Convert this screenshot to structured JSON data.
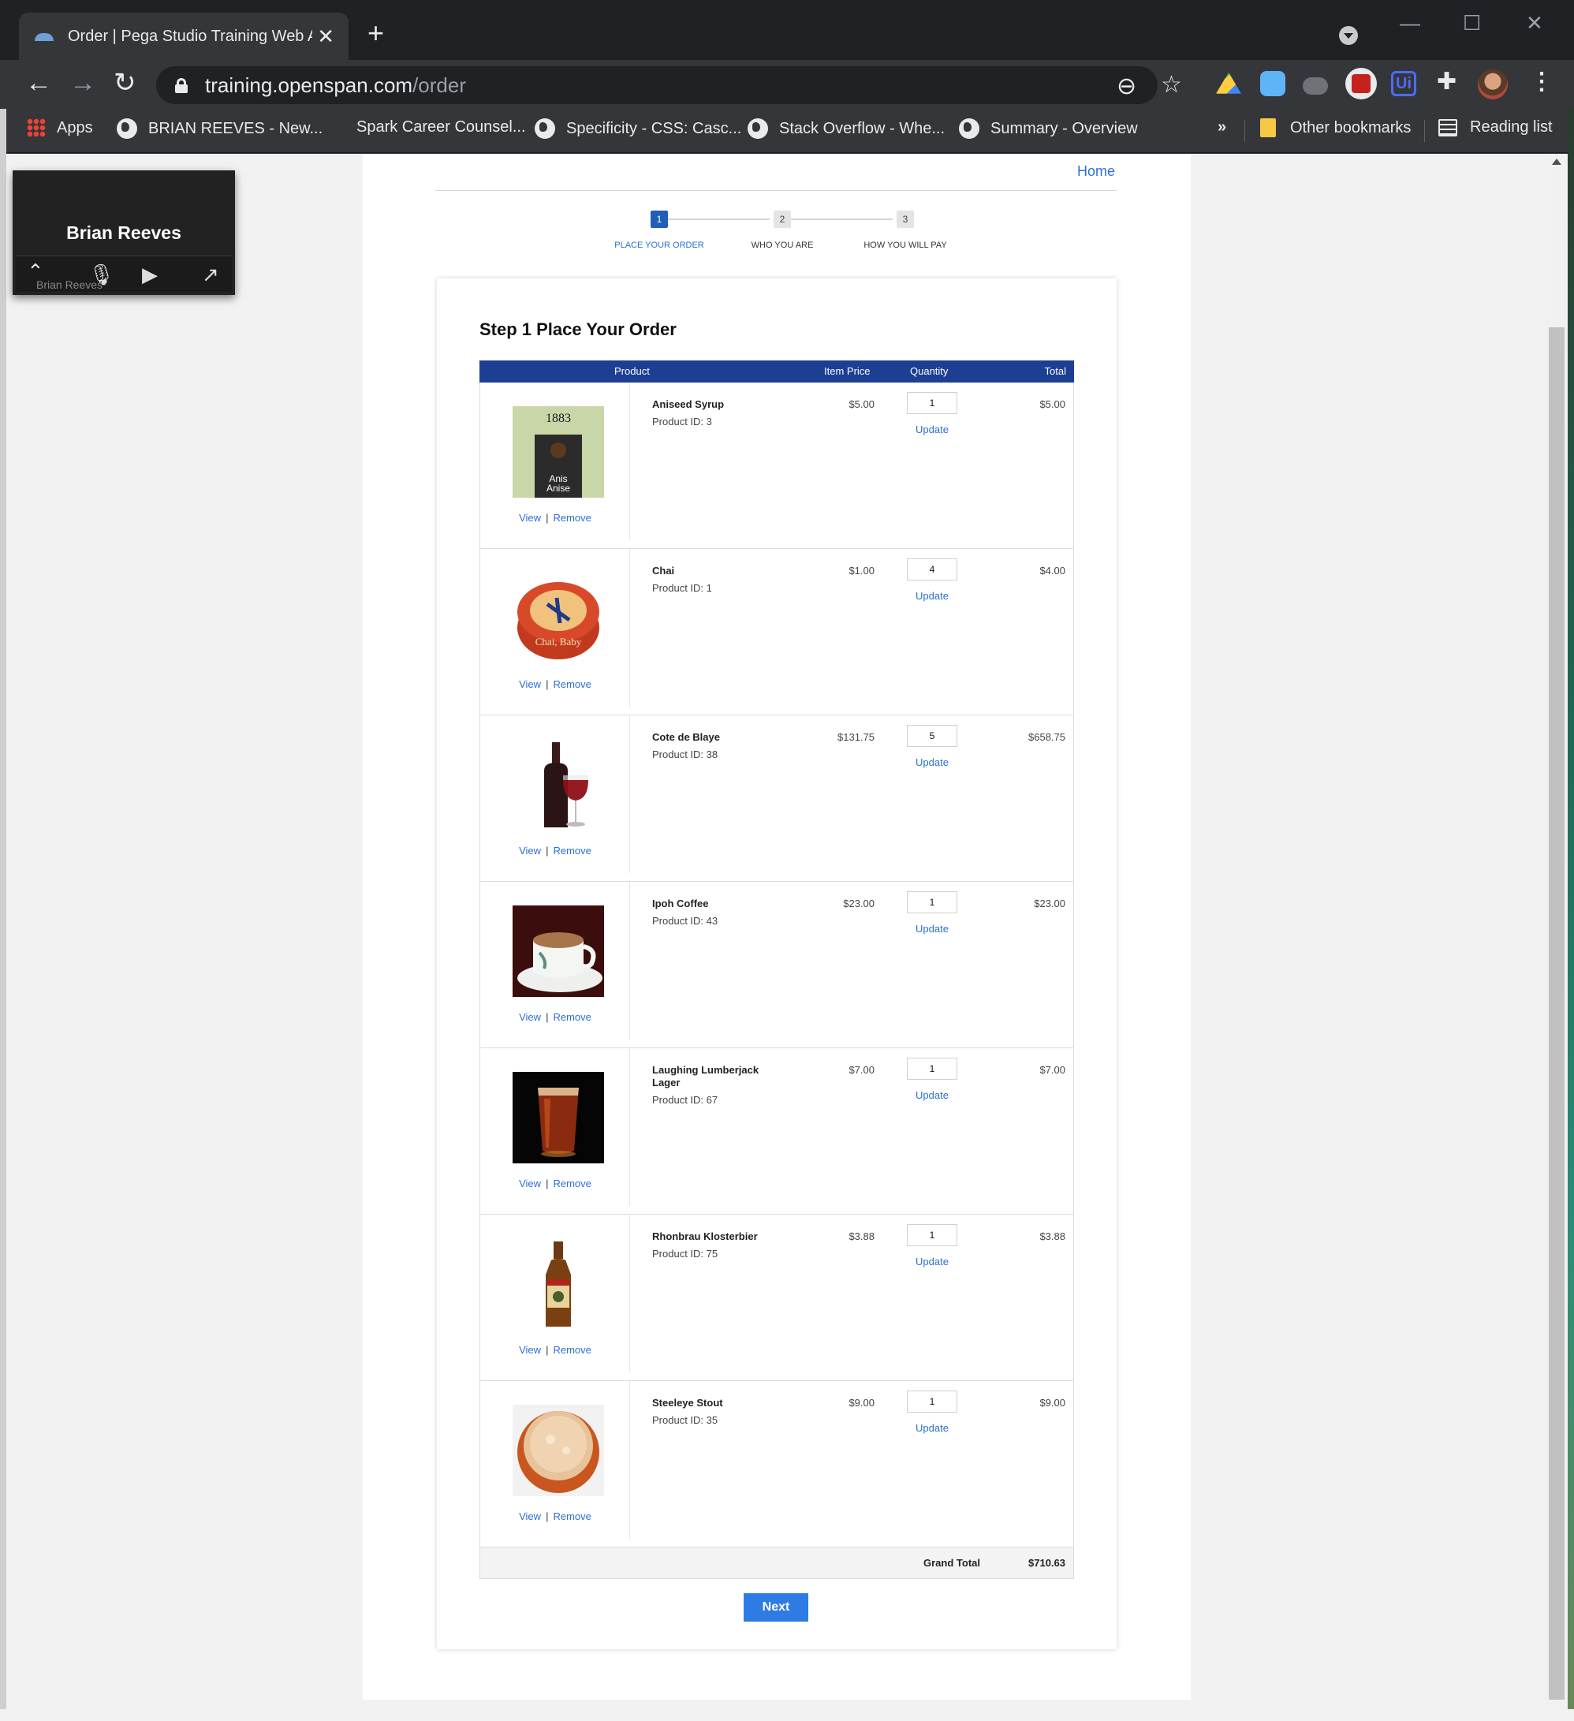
{
  "browser": {
    "tab_title": "Order | Pega Studio Training Web Ap",
    "url_host": "training.openspan.com",
    "url_path": "/order",
    "bookmarks": [
      {
        "label": "Apps",
        "icon": "apps-grid-icon"
      },
      {
        "label": "BRIAN REEVES - New...",
        "icon": "globe-icon"
      },
      {
        "label": "Spark Career Counsel...",
        "icon": "none"
      },
      {
        "label": "Specificity - CSS: Casc...",
        "icon": "globe-icon"
      },
      {
        "label": "Stack Overflow - Whe...",
        "icon": "globe-icon"
      },
      {
        "label": "Summary - Overview",
        "icon": "globe-icon"
      }
    ],
    "other_bookmarks": "Other bookmarks",
    "reading_list": "Reading list"
  },
  "zoom_overlay": {
    "name": "Brian Reeves",
    "sub_name": "Brian Reeves"
  },
  "page": {
    "home_link": "Home",
    "steps": [
      {
        "num": "1",
        "label": "PLACE YOUR ORDER",
        "active": true
      },
      {
        "num": "2",
        "label": "WHO YOU ARE",
        "active": false
      },
      {
        "num": "3",
        "label": "HOW YOU WILL PAY",
        "active": false
      }
    ],
    "title": "Step 1 Place Your Order",
    "columns": {
      "product": "Product",
      "price": "Item Price",
      "quantity": "Quantity",
      "total": "Total"
    },
    "view_label": "View",
    "remove_label": "Remove",
    "update_label": "Update",
    "items": [
      {
        "name": "Aniseed Syrup",
        "product_id": "Product ID: 3",
        "price": "$5.00",
        "qty": "1",
        "total": "$5.00",
        "image": "aniseed-syrup-image"
      },
      {
        "name": "Chai",
        "product_id": "Product ID: 1",
        "price": "$1.00",
        "qty": "4",
        "total": "$4.00",
        "image": "chai-tin-image"
      },
      {
        "name": "Cote de Blaye",
        "product_id": "Product ID: 38",
        "price": "$131.75",
        "qty": "5",
        "total": "$658.75",
        "image": "wine-bottle-image"
      },
      {
        "name": "Ipoh Coffee",
        "product_id": "Product ID: 43",
        "price": "$23.00",
        "qty": "1",
        "total": "$23.00",
        "image": "coffee-cup-image"
      },
      {
        "name": "Laughing Lumberjack Lager",
        "product_id": "Product ID: 67",
        "price": "$7.00",
        "qty": "1",
        "total": "$7.00",
        "image": "lager-glass-image"
      },
      {
        "name": "Rhonbrau Klosterbier",
        "product_id": "Product ID: 75",
        "price": "$3.88",
        "qty": "1",
        "total": "$3.88",
        "image": "beer-bottle-image"
      },
      {
        "name": "Steeleye Stout",
        "product_id": "Product ID: 35",
        "price": "$9.00",
        "qty": "1",
        "total": "$9.00",
        "image": "stout-glass-image"
      }
    ],
    "grand_total_label": "Grand Total",
    "grand_total": "$710.63",
    "next_label": "Next"
  }
}
